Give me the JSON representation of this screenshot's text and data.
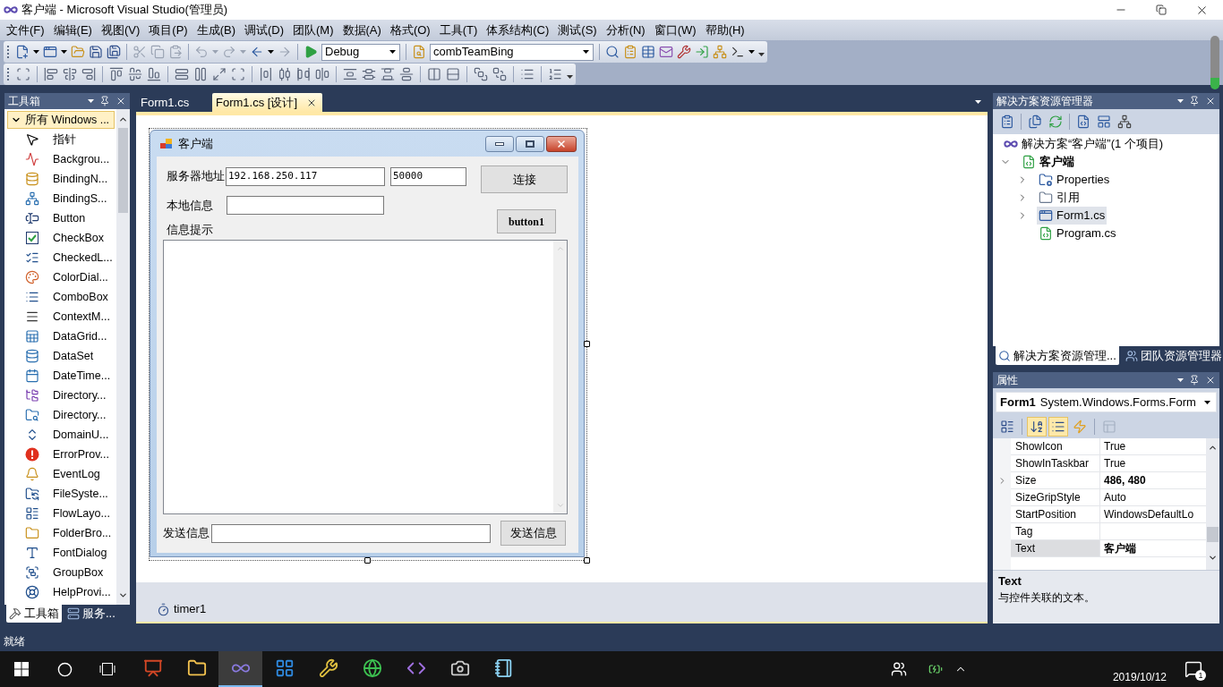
{
  "window": {
    "title": "客户端 - Microsoft Visual Studio(管理员)"
  },
  "menu": [
    "文件(F)",
    "编辑(E)",
    "视图(V)",
    "项目(P)",
    "生成(B)",
    "调试(D)",
    "团队(M)",
    "数据(A)",
    "格式(O)",
    "工具(T)",
    "体系结构(C)",
    "测试(S)",
    "分析(N)",
    "窗口(W)",
    "帮助(H)"
  ],
  "toolbar": {
    "configuration": "Debug",
    "find_combo": "combTeamBing"
  },
  "toolbox": {
    "title": "工具箱",
    "group": {
      "label": "所有 Windows ...",
      "expanded": true
    },
    "items": [
      {
        "label": "指针",
        "selected": false
      },
      {
        "label": "Backgrou...",
        "selected": false
      },
      {
        "label": "BindingN...",
        "selected": false
      },
      {
        "label": "BindingS...",
        "selected": false
      },
      {
        "label": "Button",
        "selected": false
      },
      {
        "label": "CheckBox",
        "selected": false
      },
      {
        "label": "CheckedL...",
        "selected": false
      },
      {
        "label": "ColorDial...",
        "selected": false
      },
      {
        "label": "ComboBox",
        "selected": false
      },
      {
        "label": "ContextM...",
        "selected": false
      },
      {
        "label": "DataGrid...",
        "selected": false
      },
      {
        "label": "DataSet",
        "selected": false
      },
      {
        "label": "DateTime...",
        "selected": false
      },
      {
        "label": "Directory...",
        "selected": false
      },
      {
        "label": "Directory...",
        "selected": false
      },
      {
        "label": "DomainU...",
        "selected": false
      },
      {
        "label": "ErrorProv...",
        "selected": false
      },
      {
        "label": "EventLog",
        "selected": false
      },
      {
        "label": "FileSyste...",
        "selected": false
      },
      {
        "label": "FlowLayo...",
        "selected": false
      },
      {
        "label": "FolderBro...",
        "selected": false
      },
      {
        "label": "FontDialog",
        "selected": false
      },
      {
        "label": "GroupBox",
        "selected": false
      },
      {
        "label": "HelpProvi...",
        "selected": false
      }
    ],
    "tabs": [
      {
        "label": "工具箱",
        "selected": true
      },
      {
        "label": "服务...",
        "selected": false
      }
    ]
  },
  "editor": {
    "tabs": [
      {
        "label": "Form1.cs",
        "selected": false
      },
      {
        "label": "Form1.cs [设计]",
        "selected": true
      }
    ],
    "form": {
      "title": "客户端",
      "server_label": "服务器地址",
      "server_ip": "192.168.250.117",
      "server_port": "50000",
      "connect_button": "连接",
      "local_label": "本地信息",
      "button1": "button1",
      "info_label": "信息提示",
      "send_label": "发送信息",
      "send_button": "发送信息"
    },
    "tray": [
      {
        "label": "timer1"
      }
    ]
  },
  "solution_explorer": {
    "title": "解决方案资源管理器",
    "solution": {
      "label": "解决方案“客户端”(1 个项目)",
      "selected": false
    },
    "project": {
      "label": "客户端",
      "expanded": true,
      "selected": false,
      "items": [
        {
          "label": "Properties",
          "expanded": false,
          "selected": false
        },
        {
          "label": "引用",
          "expanded": false,
          "selected": false
        },
        {
          "label": "Form1.cs",
          "expanded": false,
          "selected": true
        },
        {
          "label": "Program.cs",
          "selected": false
        }
      ]
    },
    "tabs": [
      {
        "label": "解决方案资源管理...",
        "selected": true
      },
      {
        "label": "团队资源管理器",
        "selected": false
      }
    ]
  },
  "properties": {
    "title": "属性",
    "object_name": "Form1",
    "object_type": "System.Windows.Forms.Form",
    "view_buttons": [
      {
        "selected": false,
        "disabled": false
      },
      {
        "selected": true,
        "disabled": false
      },
      {
        "selected": true,
        "disabled": false
      },
      {
        "selected": false,
        "disabled": false
      },
      {
        "selected": false,
        "disabled": true
      }
    ],
    "rows": [
      {
        "name": "ShowIcon",
        "value": "True",
        "modified": false,
        "selected": false
      },
      {
        "name": "ShowInTaskbar",
        "value": "True",
        "modified": false,
        "selected": false
      },
      {
        "name": "Size",
        "value": "486, 480",
        "modified": true,
        "selected": false,
        "expanded": false
      },
      {
        "name": "SizeGripStyle",
        "value": "Auto",
        "modified": false,
        "selected": false
      },
      {
        "name": "StartPosition",
        "value": "WindowsDefaultLo",
        "modified": false,
        "selected": false
      },
      {
        "name": "Tag",
        "selected": false
      },
      {
        "name": "Text",
        "value": "客户端",
        "modified": true,
        "selected": true
      }
    ],
    "description": {
      "title": "Text",
      "text": "与控件关联的文本。"
    }
  },
  "status_bar": {
    "text": "就绪"
  },
  "taskbar": {
    "apps": [
      {
        "selected": false
      },
      {
        "selected": false
      },
      {
        "selected": true
      },
      {
        "selected": false
      },
      {
        "selected": false
      },
      {
        "selected": false
      },
      {
        "selected": false
      },
      {
        "selected": false
      },
      {
        "selected": false
      }
    ],
    "date": "2019/10/12",
    "notification_count": "1"
  }
}
